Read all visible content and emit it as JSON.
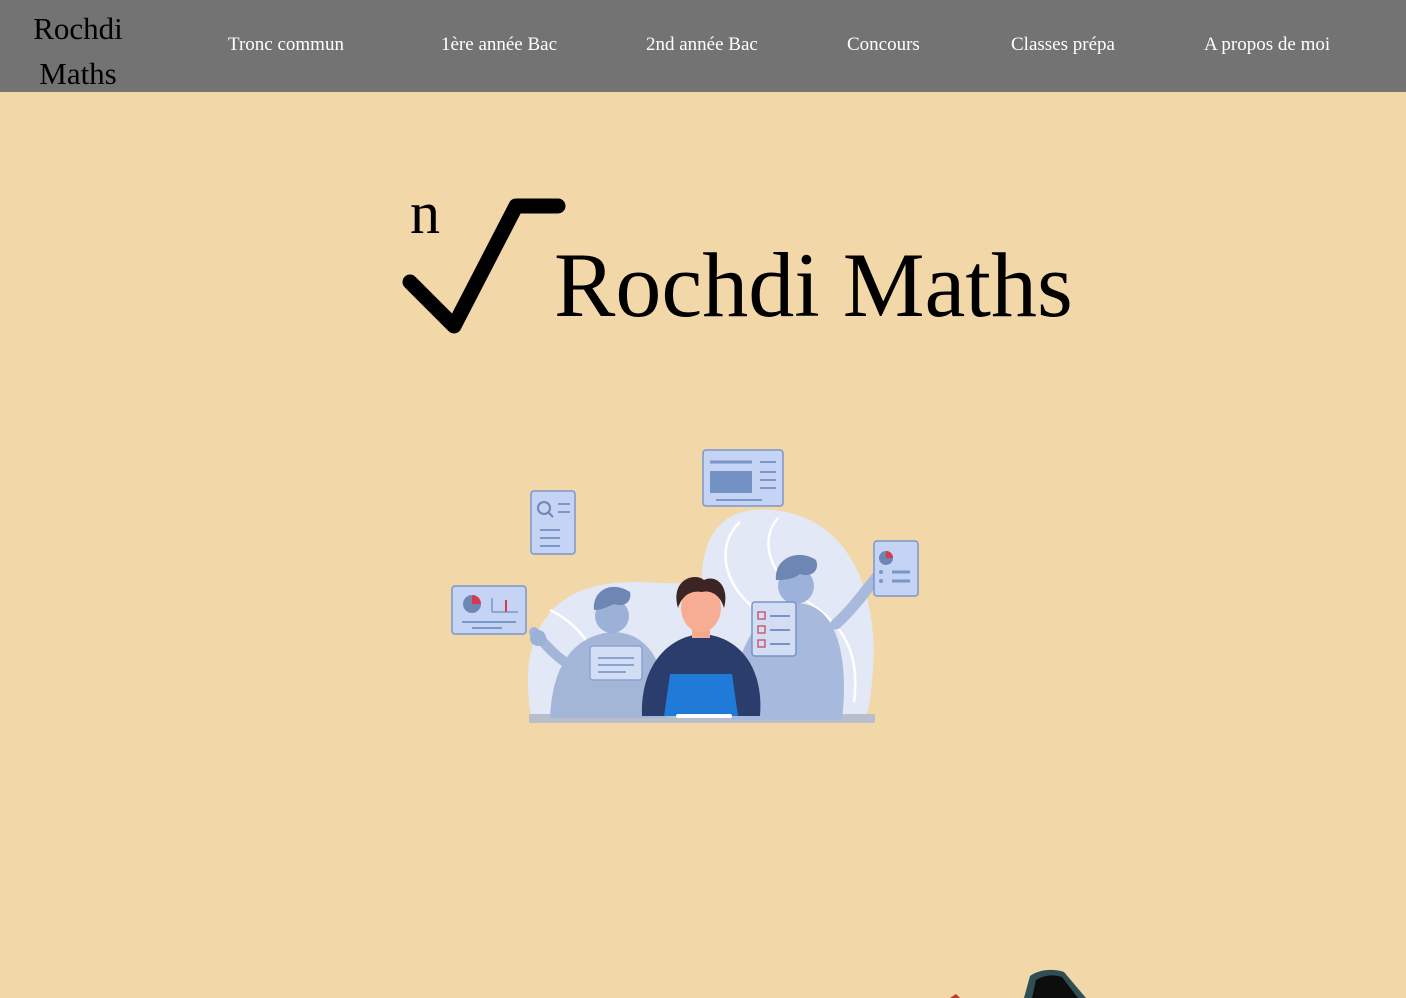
{
  "brand": {
    "line1": "Rochdi",
    "line2": "Maths"
  },
  "nav": {
    "items": [
      {
        "label": "Tronc commun"
      },
      {
        "label": "1ère année Bac"
      },
      {
        "label": "2nd année Bac"
      },
      {
        "label": "Concours"
      },
      {
        "label": "Classes prépa"
      },
      {
        "label": "A propos de moi"
      }
    ]
  },
  "hero": {
    "root_index": "n",
    "title": "Rochdi Maths",
    "illustration_icon": "team-working-on-laptop-illustration"
  },
  "colors": {
    "background": "#f2d7a9",
    "navbar": "#737373",
    "nav_text": "#ffffff",
    "text": "#000000",
    "illustration_blue": "#8fa9d6",
    "laptop_blue": "#1f7ad8"
  }
}
